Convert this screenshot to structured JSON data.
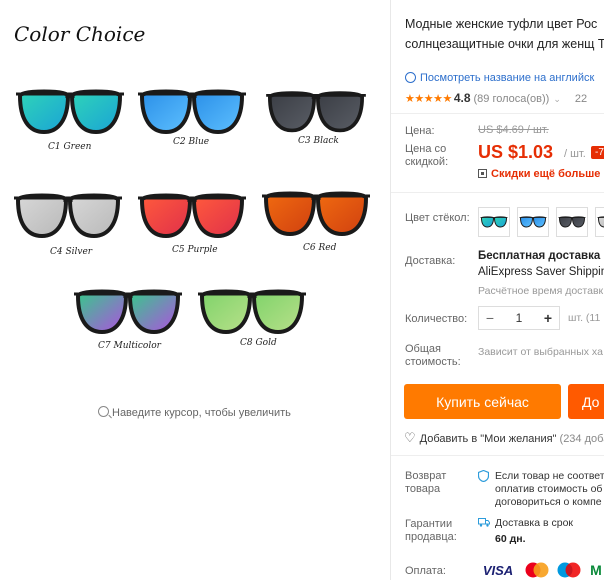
{
  "gallery": {
    "title": "Color Choice",
    "zoom_hint": "Наведите курсор, чтобы увеличить",
    "variants": [
      {
        "label": "C1 Green",
        "lens": "#2fd4b8",
        "lens2": "#1aa3d6"
      },
      {
        "label": "C2 Blue",
        "lens": "#2a8fe8",
        "lens2": "#5ec0ff"
      },
      {
        "label": "C3 Black",
        "lens": "#3a3d44",
        "lens2": "#5a5e66"
      },
      {
        "label": "C4 Silver",
        "lens": "#d8d8d8",
        "lens2": "#b8b8b8"
      },
      {
        "label": "C5 Purple",
        "lens": "#ff5a3c",
        "lens2": "#e0304a"
      },
      {
        "label": "C6 Red",
        "lens": "#f06a10",
        "lens2": "#d04010"
      },
      {
        "label": "C7 Multicolor",
        "lens": "#36c98a",
        "lens2": "#b050e0"
      },
      {
        "label": "C8 Gold",
        "lens": "#7fd36a",
        "lens2": "#b8e08a"
      }
    ]
  },
  "product": {
    "title": "Модные женские туфли цвет Рос солнцезащитные очки для женщ Twin луч",
    "translate_link": "Посмотреть название на английск",
    "stars": "★★★★★",
    "rating": "4.8",
    "votes": "(89 голоса(ов))",
    "orders": "22"
  },
  "price": {
    "label": "Цена:",
    "old": "US $4.69 / шт.",
    "discount_label": "Цена со скидкой:",
    "new": "US $1.03",
    "unit": "/ шт.",
    "badge": "-7",
    "promo": "Скидки ещё больше в п"
  },
  "lens_color": {
    "label": "Цвет стёкол:"
  },
  "shipping": {
    "label": "Доставка:",
    "title": "Бесплатная доставка в Р",
    "method": "AliExpress Saver Shipping",
    "estimate": "Расчётное время доставк"
  },
  "quantity": {
    "label": "Количество:",
    "value": "1",
    "minus": "−",
    "plus": "+",
    "unit": "шт. (11"
  },
  "total": {
    "label": "Общая стоимость:",
    "note": "Зависит от выбранных ха"
  },
  "actions": {
    "buy": "Купить сейчас",
    "cart": "До",
    "wishlist": "Добавить в \"Мои желания\"",
    "wishlist_count": "(234 доба"
  },
  "returns": {
    "label": "Возврат товара",
    "text": "Если товар не соответ оплатив стоимость об договориться о компе"
  },
  "guarantee": {
    "label": "Гарантии продавца:",
    "text": "Доставка в срок",
    "days": "60 дн."
  },
  "payment": {
    "label": "Оплата:",
    "methods": [
      "VISA",
      "MasterCard",
      "Maestro",
      "M"
    ]
  }
}
